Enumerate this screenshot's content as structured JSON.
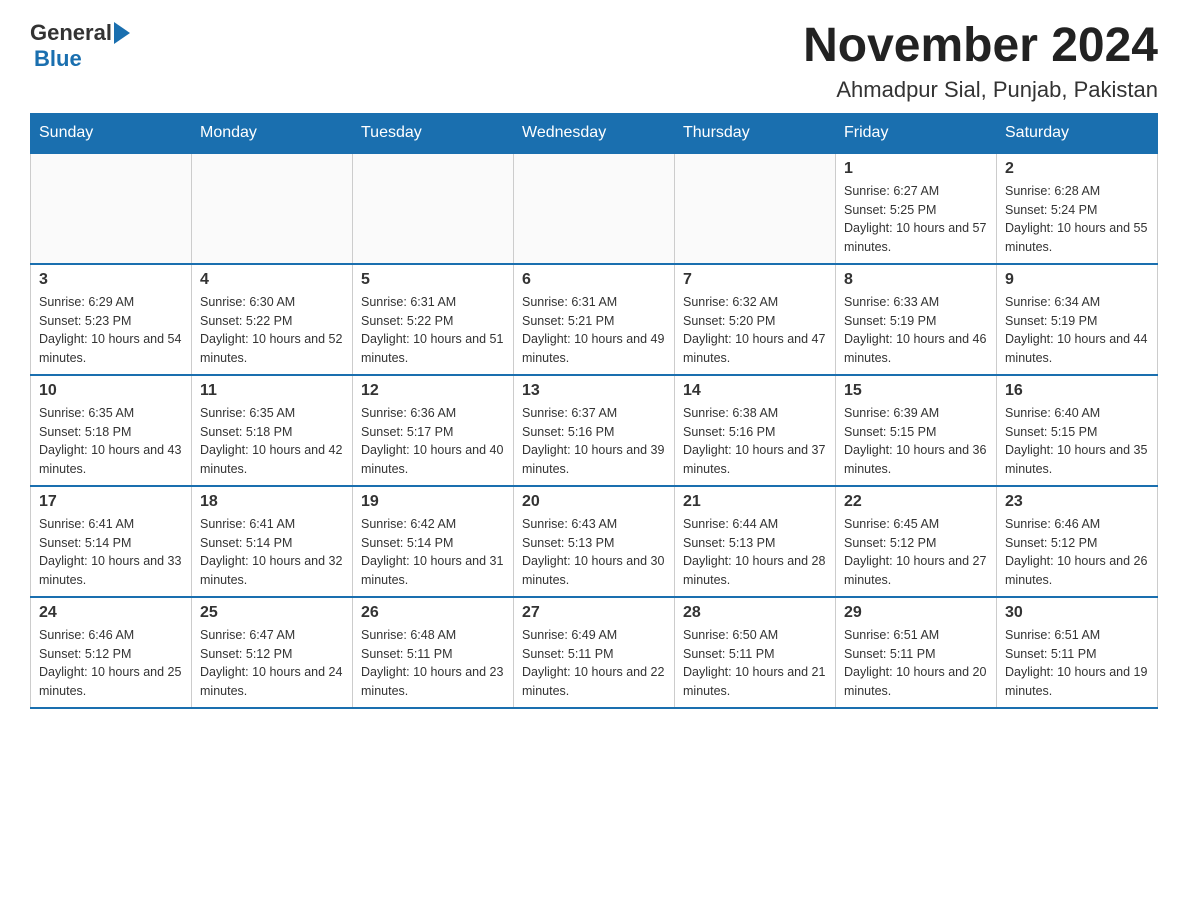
{
  "header": {
    "logo_general": "General",
    "logo_blue": "Blue",
    "month_year": "November 2024",
    "location": "Ahmadpur Sial, Punjab, Pakistan"
  },
  "days_of_week": [
    "Sunday",
    "Monday",
    "Tuesday",
    "Wednesday",
    "Thursday",
    "Friday",
    "Saturday"
  ],
  "weeks": [
    [
      {
        "day": "",
        "info": ""
      },
      {
        "day": "",
        "info": ""
      },
      {
        "day": "",
        "info": ""
      },
      {
        "day": "",
        "info": ""
      },
      {
        "day": "",
        "info": ""
      },
      {
        "day": "1",
        "info": "Sunrise: 6:27 AM\nSunset: 5:25 PM\nDaylight: 10 hours and 57 minutes."
      },
      {
        "day": "2",
        "info": "Sunrise: 6:28 AM\nSunset: 5:24 PM\nDaylight: 10 hours and 55 minutes."
      }
    ],
    [
      {
        "day": "3",
        "info": "Sunrise: 6:29 AM\nSunset: 5:23 PM\nDaylight: 10 hours and 54 minutes."
      },
      {
        "day": "4",
        "info": "Sunrise: 6:30 AM\nSunset: 5:22 PM\nDaylight: 10 hours and 52 minutes."
      },
      {
        "day": "5",
        "info": "Sunrise: 6:31 AM\nSunset: 5:22 PM\nDaylight: 10 hours and 51 minutes."
      },
      {
        "day": "6",
        "info": "Sunrise: 6:31 AM\nSunset: 5:21 PM\nDaylight: 10 hours and 49 minutes."
      },
      {
        "day": "7",
        "info": "Sunrise: 6:32 AM\nSunset: 5:20 PM\nDaylight: 10 hours and 47 minutes."
      },
      {
        "day": "8",
        "info": "Sunrise: 6:33 AM\nSunset: 5:19 PM\nDaylight: 10 hours and 46 minutes."
      },
      {
        "day": "9",
        "info": "Sunrise: 6:34 AM\nSunset: 5:19 PM\nDaylight: 10 hours and 44 minutes."
      }
    ],
    [
      {
        "day": "10",
        "info": "Sunrise: 6:35 AM\nSunset: 5:18 PM\nDaylight: 10 hours and 43 minutes."
      },
      {
        "day": "11",
        "info": "Sunrise: 6:35 AM\nSunset: 5:18 PM\nDaylight: 10 hours and 42 minutes."
      },
      {
        "day": "12",
        "info": "Sunrise: 6:36 AM\nSunset: 5:17 PM\nDaylight: 10 hours and 40 minutes."
      },
      {
        "day": "13",
        "info": "Sunrise: 6:37 AM\nSunset: 5:16 PM\nDaylight: 10 hours and 39 minutes."
      },
      {
        "day": "14",
        "info": "Sunrise: 6:38 AM\nSunset: 5:16 PM\nDaylight: 10 hours and 37 minutes."
      },
      {
        "day": "15",
        "info": "Sunrise: 6:39 AM\nSunset: 5:15 PM\nDaylight: 10 hours and 36 minutes."
      },
      {
        "day": "16",
        "info": "Sunrise: 6:40 AM\nSunset: 5:15 PM\nDaylight: 10 hours and 35 minutes."
      }
    ],
    [
      {
        "day": "17",
        "info": "Sunrise: 6:41 AM\nSunset: 5:14 PM\nDaylight: 10 hours and 33 minutes."
      },
      {
        "day": "18",
        "info": "Sunrise: 6:41 AM\nSunset: 5:14 PM\nDaylight: 10 hours and 32 minutes."
      },
      {
        "day": "19",
        "info": "Sunrise: 6:42 AM\nSunset: 5:14 PM\nDaylight: 10 hours and 31 minutes."
      },
      {
        "day": "20",
        "info": "Sunrise: 6:43 AM\nSunset: 5:13 PM\nDaylight: 10 hours and 30 minutes."
      },
      {
        "day": "21",
        "info": "Sunrise: 6:44 AM\nSunset: 5:13 PM\nDaylight: 10 hours and 28 minutes."
      },
      {
        "day": "22",
        "info": "Sunrise: 6:45 AM\nSunset: 5:12 PM\nDaylight: 10 hours and 27 minutes."
      },
      {
        "day": "23",
        "info": "Sunrise: 6:46 AM\nSunset: 5:12 PM\nDaylight: 10 hours and 26 minutes."
      }
    ],
    [
      {
        "day": "24",
        "info": "Sunrise: 6:46 AM\nSunset: 5:12 PM\nDaylight: 10 hours and 25 minutes."
      },
      {
        "day": "25",
        "info": "Sunrise: 6:47 AM\nSunset: 5:12 PM\nDaylight: 10 hours and 24 minutes."
      },
      {
        "day": "26",
        "info": "Sunrise: 6:48 AM\nSunset: 5:11 PM\nDaylight: 10 hours and 23 minutes."
      },
      {
        "day": "27",
        "info": "Sunrise: 6:49 AM\nSunset: 5:11 PM\nDaylight: 10 hours and 22 minutes."
      },
      {
        "day": "28",
        "info": "Sunrise: 6:50 AM\nSunset: 5:11 PM\nDaylight: 10 hours and 21 minutes."
      },
      {
        "day": "29",
        "info": "Sunrise: 6:51 AM\nSunset: 5:11 PM\nDaylight: 10 hours and 20 minutes."
      },
      {
        "day": "30",
        "info": "Sunrise: 6:51 AM\nSunset: 5:11 PM\nDaylight: 10 hours and 19 minutes."
      }
    ]
  ]
}
